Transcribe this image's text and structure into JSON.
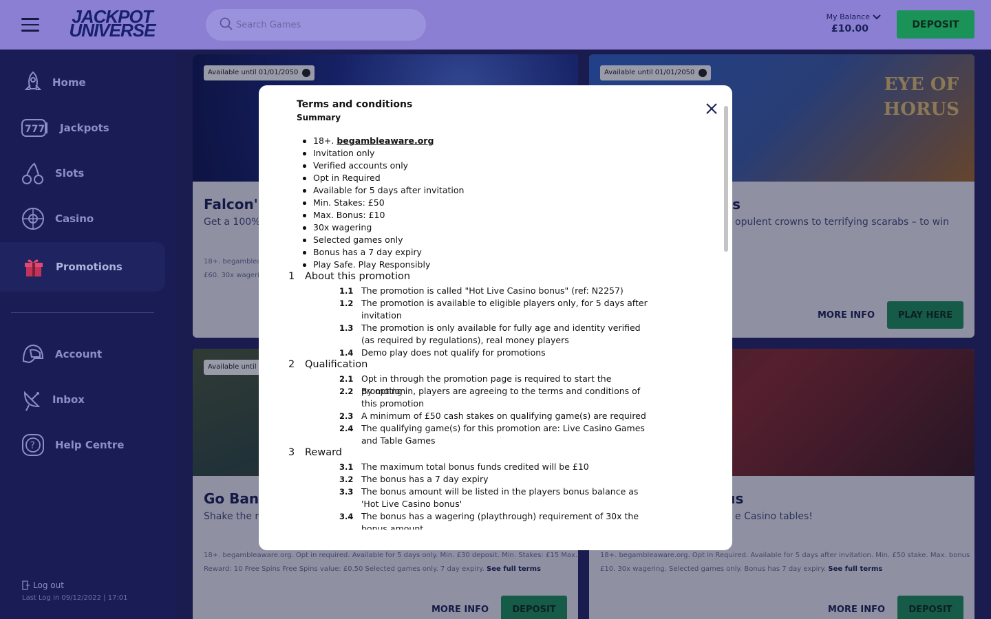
{
  "header": {
    "logo_line1": "JACKPOT",
    "logo_line2": "UNIVERSE",
    "search_placeholder": "Search Games",
    "balance_label": "My Balance",
    "balance_amount": "£10.00",
    "deposit_label": "DEPOSIT"
  },
  "sidebar": {
    "items": [
      {
        "label": "Home",
        "icon": "rocket-icon"
      },
      {
        "label": "Jackpots",
        "icon": "slot-777-icon"
      },
      {
        "label": "Slots",
        "icon": "cherries-icon"
      },
      {
        "label": "Casino",
        "icon": "roulette-icon"
      },
      {
        "label": "Promotions",
        "icon": "gift-icon"
      },
      {
        "label": "Account",
        "icon": "helmet-icon"
      },
      {
        "label": "Inbox",
        "icon": "satellite-dish-icon"
      },
      {
        "label": "Help Centre",
        "icon": "help-icon"
      }
    ],
    "logout": "Log out",
    "last_log": "Last Log in 09/12/2022 | 17:01"
  },
  "cards": [
    {
      "badge": "Available until 01/01/2050",
      "title": "Falcon's",
      "sub": "Get a 100%",
      "terms1": "18+. begambleaware",
      "terms2": "£60. 30x wagerin"
    },
    {
      "badge": "Available until 01/01/2050",
      "title_right": "rus",
      "sub_right": "opulent crowns to terrifying scarabs – to win",
      "terms_tail": "s",
      "more": "MORE INFO",
      "cta": "PLAY HERE",
      "art_text1": "EYE OF",
      "art_text2": "HORUS"
    },
    {
      "badge": "Available until",
      "title": "Go Bana",
      "sub": "Shake the r",
      "terms1": "18+. begambleaware.org. Opt in required. Available for 5 days only. Min. £30 deposit. Min. Stakes: £15 Max.",
      "terms2": "Reward: 10 Free Spins Free Spins value: £0.50 Selected games only. 7 day expiry.",
      "see_full": "See full terms",
      "more": "MORE INFO",
      "cta": "DEPOSIT"
    },
    {
      "title_right": "nus",
      "sub_right": "e Casino tables!",
      "terms1": "18+. begambleaware.org. Opt in Required. Available for 5 days after invitation. Min. £50 stake. Max. bonus",
      "terms2": "£10. 30x wagering. Selected games only. Bonus has 7 day expiry.",
      "see_full": "See full terms",
      "more": "MORE INFO",
      "cta": "DEPOSIT"
    }
  ],
  "modal": {
    "title": "Terms and conditions",
    "summary": "Summary",
    "bullets": [
      "Invitation only",
      "Verified accounts only",
      "Opt in Required",
      "Available for 5 days after invitation",
      "Min. Stakes: £50",
      "Max. Bonus: £10",
      "30x wagering",
      "Selected games only",
      "Bonus has a 7 day expiry",
      "Play Safe. Play Responsibly"
    ],
    "first_bullet_prefix": "18+.",
    "first_bullet_link": "begambleaware.org",
    "sections": [
      {
        "num": "1",
        "title": "About this promotion",
        "items": [
          {
            "n": "1.1",
            "t": "The promotion is called \"Hot Live Casino bonus\" (ref: N2257)"
          },
          {
            "n": "1.2",
            "t": "The promotion is available to eligible players only, for 5 days after invitation"
          },
          {
            "n": "1.3",
            "t": "The promotion is only available for fully age and identity verified (as required by regulations), real money players"
          },
          {
            "n": "1.4",
            "t": "Demo play does not qualify for promotions"
          }
        ]
      },
      {
        "num": "2",
        "title": "Qualification",
        "items": [
          {
            "n": "2.1",
            "t": "Opt in through the promotion page is required to start the promotion"
          },
          {
            "n": "2.2",
            "t": "By opting in, players are agreeing to the terms and conditions of this promotion"
          },
          {
            "n": "2.3",
            "t": "A minimum of £50 cash stakes on qualifying game(s) are required"
          },
          {
            "n": "2.4",
            "t": "The qualifying game(s) for this promotion are: Live Casino Games and Table Games"
          }
        ]
      },
      {
        "num": "3",
        "title": "Reward",
        "items": [
          {
            "n": "3.1",
            "t": "The maximum total bonus funds credited will be £10"
          },
          {
            "n": "3.2",
            "t": "The bonus has a 7 day expiry"
          },
          {
            "n": "3.3",
            "t": "The bonus amount will be listed in the players bonus balance as 'Hot Live Casino bonus'"
          },
          {
            "n": "3.4",
            "t": "The bonus has a wagering (playthrough) requirement of 30x the bonus amount"
          }
        ]
      }
    ]
  },
  "colors": {
    "header": "#8a7fd3",
    "sidebar": "#1a1d55",
    "accent_green": "#1a9258",
    "navy": "#1a1f55"
  }
}
